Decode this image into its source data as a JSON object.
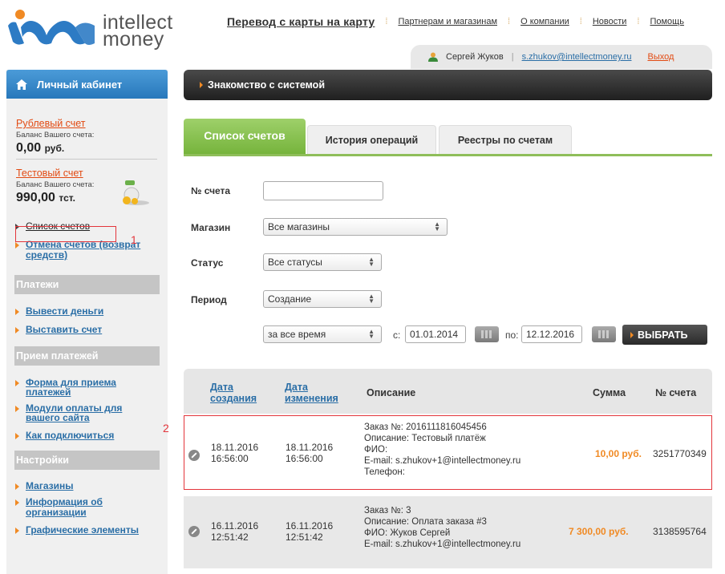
{
  "logo": {
    "line1": "intellect",
    "line2": "money"
  },
  "topnav": {
    "main": "Перевод с карты на карту",
    "items": [
      "Партнерам и магазинам",
      "О компании",
      "Новости",
      "Помощь"
    ]
  },
  "userbar": {
    "name": "Сергей Жуков",
    "email": "s.zhukov@intellectmoney.ru",
    "logout": "Выход"
  },
  "sidebar": {
    "header": "Личный кабинет",
    "accounts": [
      {
        "name": "Рублевый счет",
        "caption": "Баланс Вашего счета:",
        "amount": "0,00",
        "currency": "руб."
      },
      {
        "name": "Тестовый счет",
        "caption": "Баланс Вашего счета:",
        "amount": "990,00",
        "currency": "тст."
      }
    ],
    "account_links": [
      "Список счетов",
      "Отмена счетов (возврат средств)"
    ],
    "groups": [
      {
        "title": "Платежи",
        "items": [
          "Вывести деньги",
          "Выставить счет"
        ]
      },
      {
        "title": "Прием платежей",
        "items": [
          "Форма для приема платежей",
          "Модули оплаты для вашего сайта",
          "Как подключиться"
        ]
      },
      {
        "title": "Настройки",
        "items": [
          "Магазины",
          "Информация об организации",
          "Графические элементы"
        ]
      }
    ]
  },
  "annotations": {
    "label1": "1",
    "label2": "2"
  },
  "main": {
    "title": "Знакомство с системой",
    "tabs": [
      "Список счетов",
      "История операций",
      "Реестры по счетам"
    ],
    "filters": {
      "account_label": "№ счета",
      "account_value": "",
      "shop_label": "Магазин",
      "shop_value": "Все магазины",
      "status_label": "Статус",
      "status_value": "Все статусы",
      "period_label": "Период",
      "period_value": "Создание",
      "range_value": "за все время",
      "from_label": "с:",
      "from_date": "01.01.2014",
      "to_label": "по:",
      "to_date": "12.12.2016",
      "submit": "ВЫБРАТЬ"
    },
    "table": {
      "columns": {
        "created": "Дата создания",
        "modified": "Дата изменения",
        "description": "Описание",
        "amount": "Сумма",
        "account": "№ счета"
      },
      "rows": [
        {
          "created_date": "18.11.2016",
          "created_time": "16:56:00",
          "modified_date": "18.11.2016",
          "modified_time": "16:56:00",
          "desc": [
            "Заказ №: 2016111816045456",
            "Описание: Тестовый платёж",
            "ФИО:",
            "E-mail: s.zhukov+1@intellectmoney.ru",
            "Телефон:"
          ],
          "amount": "10,00 руб.",
          "account": "3251770349"
        },
        {
          "created_date": "16.11.2016",
          "created_time": "12:51:42",
          "modified_date": "16.11.2016",
          "modified_time": "12:51:42",
          "desc": [
            "Заказ №: 3",
            "Описание: Оплата заказа #3",
            "ФИО: Жуков Сергей",
            "E-mail: s.zhukov+1@intellectmoney.ru"
          ],
          "amount": "7 300,00 руб.",
          "account": "3138595764"
        }
      ]
    }
  },
  "colors": {
    "accent_orange": "#f08a24",
    "link_blue": "#2a6ea6",
    "green_tab": "#8fbe5a",
    "highlight_red": "#e3353b"
  }
}
